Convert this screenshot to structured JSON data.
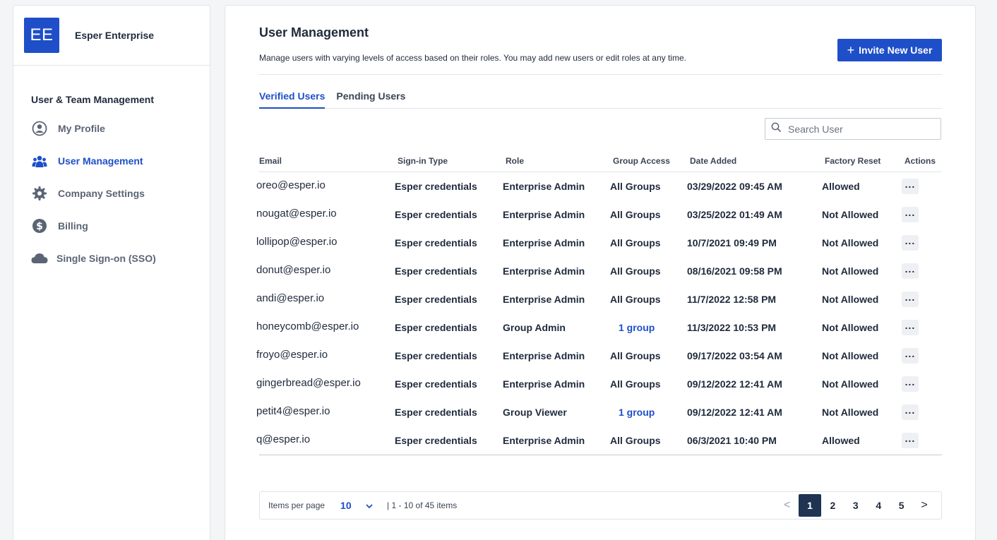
{
  "org": {
    "initials": "EE",
    "name": "Esper Enterprise"
  },
  "sidebar": {
    "section_title": "User & Team Management",
    "items": [
      {
        "label": "My Profile",
        "icon": "user-circle-icon"
      },
      {
        "label": "User Management",
        "icon": "users-icon",
        "active": true
      },
      {
        "label": "Company Settings",
        "icon": "gear-icon"
      },
      {
        "label": "Billing",
        "icon": "dollar-icon"
      },
      {
        "label": "Single Sign-on (SSO)",
        "icon": "cloud-icon"
      }
    ]
  },
  "header": {
    "title": "User Management",
    "description": "Manage users with varying levels of access based on their roles. You may add new users or edit roles at any time.",
    "invite_label": "Invite New User"
  },
  "tabs": [
    {
      "label": "Verified Users",
      "active": true
    },
    {
      "label": "Pending Users"
    }
  ],
  "search": {
    "placeholder": "Search User",
    "value": ""
  },
  "table": {
    "columns": [
      "Email",
      "Sign-in Type",
      "Role",
      "Group Access",
      "Date Added",
      "Factory Reset",
      "Actions"
    ],
    "rows": [
      {
        "email": "oreo@esper.io",
        "signin": "Esper credentials",
        "role": "Enterprise Admin",
        "group": "All Groups",
        "date": "03/29/2022 09:45 AM",
        "reset": "Allowed"
      },
      {
        "email": "nougat@esper.io",
        "signin": "Esper credentials",
        "role": "Enterprise Admin",
        "group": "All Groups",
        "date": "03/25/2022 01:49 AM",
        "reset": "Not Allowed"
      },
      {
        "email": "lollipop@esper.io",
        "signin": "Esper credentials",
        "role": "Enterprise Admin",
        "group": "All Groups",
        "date": "10/7/2021 09:49 PM",
        "reset": "Not Allowed"
      },
      {
        "email": "donut@esper.io",
        "signin": "Esper credentials",
        "role": "Enterprise Admin",
        "group": "All Groups",
        "date": "08/16/2021 09:58 PM",
        "reset": "Not Allowed"
      },
      {
        "email": "andi@esper.io",
        "signin": "Esper credentials",
        "role": "Enterprise Admin",
        "group": "All Groups",
        "date": "11/7/2022 12:58 PM",
        "reset": "Not Allowed"
      },
      {
        "email": "honeycomb@esper.io",
        "signin": "Esper credentials",
        "role": "Group Admin",
        "group": "1 group",
        "group_link": true,
        "date": "11/3/2022 10:53 PM",
        "reset": "Not Allowed"
      },
      {
        "email": "froyo@esper.io",
        "signin": "Esper credentials",
        "role": "Enterprise Admin",
        "group": "All Groups",
        "date": "09/17/2022 03:54 AM",
        "reset": "Not Allowed"
      },
      {
        "email": "gingerbread@esper.io",
        "signin": "Esper credentials",
        "role": "Enterprise Admin",
        "group": "All Groups",
        "date": "09/12/2022 12:41 AM",
        "reset": "Not Allowed"
      },
      {
        "email": "petit4@esper.io",
        "signin": "Esper credentials",
        "role": "Group Viewer",
        "group": "1 group",
        "group_link": true,
        "date": "09/12/2022 12:41 AM",
        "reset": "Not Allowed"
      },
      {
        "email": "q@esper.io",
        "signin": "Esper credentials",
        "role": "Enterprise Admin",
        "group": "All Groups",
        "date": "06/3/2021 10:40 PM",
        "reset": "Allowed"
      }
    ]
  },
  "pagination": {
    "items_per_page_label": "Items per page",
    "items_per_page": "10",
    "range": "| 1 - 10 of 45 items",
    "prev": "<",
    "next": ">",
    "pages": [
      "1",
      "2",
      "3",
      "4",
      "5"
    ],
    "current": "1"
  },
  "colors": {
    "accent": "#1e4fc9",
    "active_page": "#1f3352"
  }
}
